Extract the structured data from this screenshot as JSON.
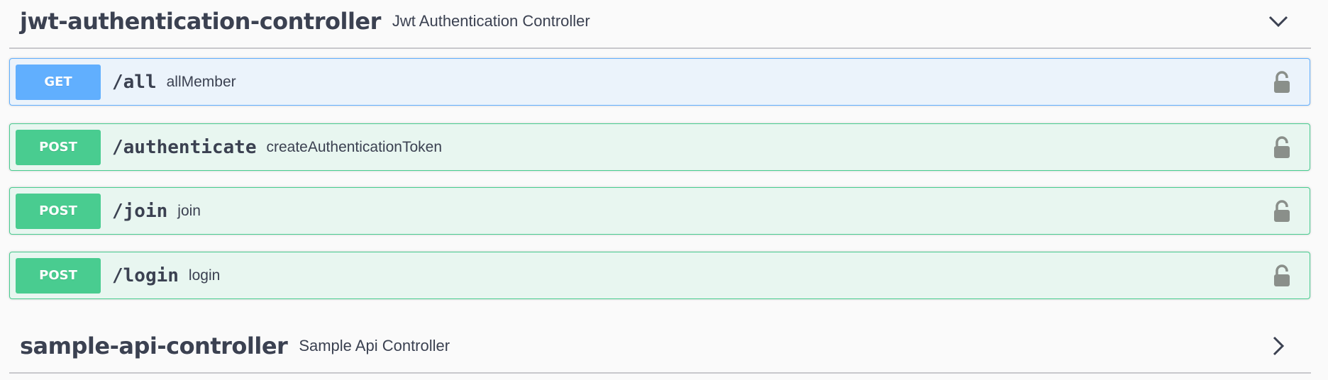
{
  "tags": [
    {
      "name": "jwt-authentication-controller",
      "description": "Jwt Authentication Controller",
      "expanded": true,
      "toggle_icon": "chevron-down-icon",
      "operations": [
        {
          "method": "GET",
          "path": "/all",
          "summary": "allMember",
          "lock_icon": "unlocked-padlock-icon"
        },
        {
          "method": "POST",
          "path": "/authenticate",
          "summary": "createAuthenticationToken",
          "lock_icon": "unlocked-padlock-icon"
        },
        {
          "method": "POST",
          "path": "/join",
          "summary": "join",
          "lock_icon": "unlocked-padlock-icon"
        },
        {
          "method": "POST",
          "path": "/login",
          "summary": "login",
          "lock_icon": "unlocked-padlock-icon"
        }
      ]
    },
    {
      "name": "sample-api-controller",
      "description": "Sample Api Controller",
      "expanded": false,
      "toggle_icon": "chevron-right-icon"
    }
  ],
  "colors": {
    "get": "#61affe",
    "get_bg": "#ebf3fb",
    "post": "#49cc90",
    "post_bg": "#e8f6f0",
    "text": "#3b4151",
    "lock": "#8a8f8a"
  }
}
